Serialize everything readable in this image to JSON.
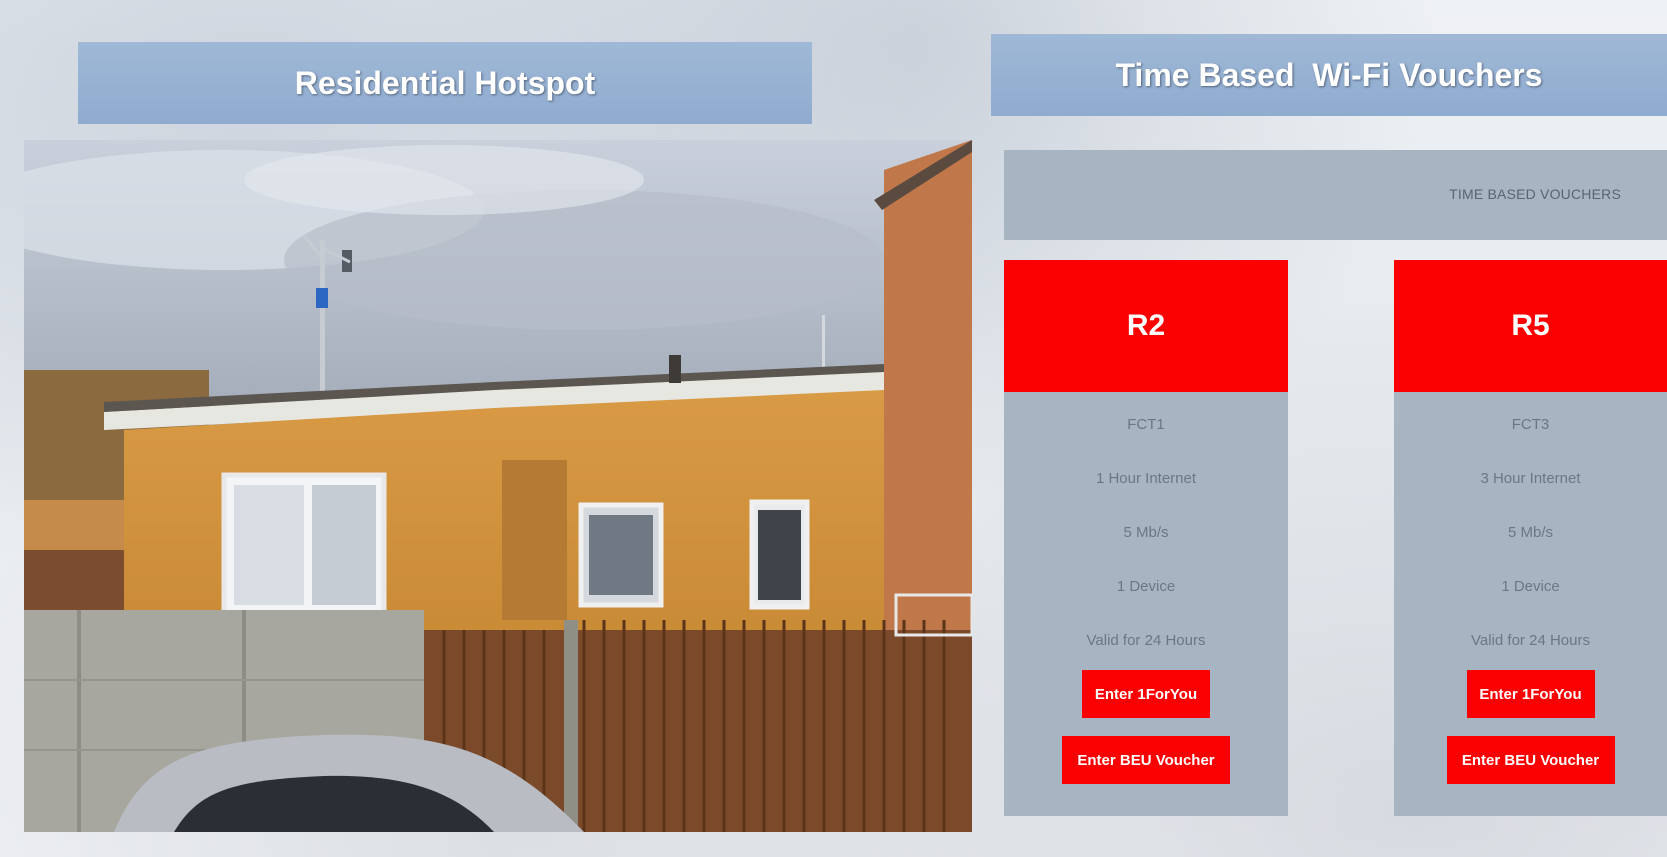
{
  "left_banner": {
    "title": "Residential Hotspot"
  },
  "right_banner": {
    "title": "Time Based  Wi-Fi Vouchers"
  },
  "vouchers_header": {
    "label": "TIME BASED VOUCHERS"
  },
  "cards": [
    {
      "price": "R2",
      "code": "FCT1",
      "duration": "1 Hour Internet",
      "speed": "5 Mb/s",
      "devices": "1 Device",
      "validity": "Valid for 24 Hours",
      "btn_ifor": "Enter 1ForYou",
      "btn_beu": "Enter BEU Voucher"
    },
    {
      "price": "R5",
      "code": "FCT3",
      "duration": "3 Hour Internet",
      "speed": "5 Mb/s",
      "devices": "1 Device",
      "validity": "Valid for 24 Hours",
      "btn_ifor": "Enter 1ForYou",
      "btn_beu": "Enter BEU Voucher"
    }
  ],
  "colors": {
    "accent_red": "#fb0000",
    "banner_blue": "#9fb8d6",
    "panel_gray": "#a7b4c2"
  }
}
